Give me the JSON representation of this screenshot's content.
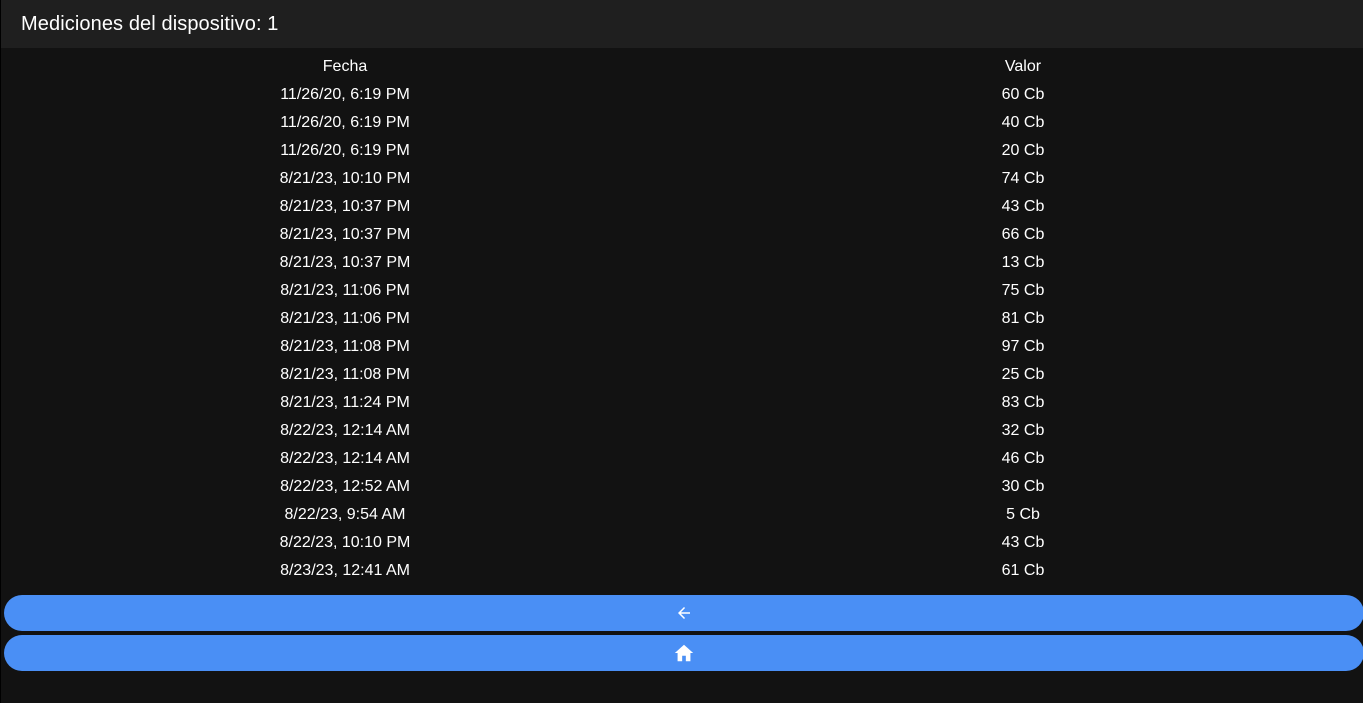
{
  "toolbar": {
    "title": "Mediciones del dispositivo: 1"
  },
  "table": {
    "headers": {
      "fecha": "Fecha",
      "valor": "Valor"
    },
    "rows": [
      {
        "fecha": "11/26/20, 6:19 PM",
        "valor": "60 Cb"
      },
      {
        "fecha": "11/26/20, 6:19 PM",
        "valor": "40 Cb"
      },
      {
        "fecha": "11/26/20, 6:19 PM",
        "valor": "20 Cb"
      },
      {
        "fecha": "8/21/23, 10:10 PM",
        "valor": "74 Cb"
      },
      {
        "fecha": "8/21/23, 10:37 PM",
        "valor": "43 Cb"
      },
      {
        "fecha": "8/21/23, 10:37 PM",
        "valor": "66 Cb"
      },
      {
        "fecha": "8/21/23, 10:37 PM",
        "valor": "13 Cb"
      },
      {
        "fecha": "8/21/23, 11:06 PM",
        "valor": "75 Cb"
      },
      {
        "fecha": "8/21/23, 11:06 PM",
        "valor": "81 Cb"
      },
      {
        "fecha": "8/21/23, 11:08 PM",
        "valor": "97 Cb"
      },
      {
        "fecha": "8/21/23, 11:08 PM",
        "valor": "25 Cb"
      },
      {
        "fecha": "8/21/23, 11:24 PM",
        "valor": "83 Cb"
      },
      {
        "fecha": "8/22/23, 12:14 AM",
        "valor": "32 Cb"
      },
      {
        "fecha": "8/22/23, 12:14 AM",
        "valor": "46 Cb"
      },
      {
        "fecha": "8/22/23, 12:52 AM",
        "valor": "30 Cb"
      },
      {
        "fecha": "8/22/23, 9:54 AM",
        "valor": "5 Cb"
      },
      {
        "fecha": "8/22/23, 10:10 PM",
        "valor": "43 Cb"
      },
      {
        "fecha": "8/23/23, 12:41 AM",
        "valor": "61 Cb"
      }
    ]
  },
  "buttons": {
    "back": {
      "icon": "arrow-left-icon"
    },
    "home": {
      "icon": "home-icon"
    }
  },
  "colors": {
    "background": "#121212",
    "toolbar": "#1f1f1f",
    "accent": "#4a8ff5",
    "text": "#ffffff"
  }
}
